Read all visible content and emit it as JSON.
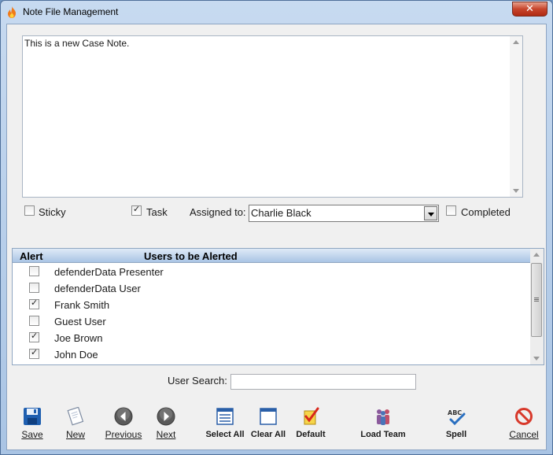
{
  "window": {
    "title": "Note File Management",
    "close_glyph": "✕"
  },
  "note": {
    "text": "This is a new Case Note."
  },
  "options": {
    "sticky_label": "Sticky",
    "sticky_checked": false,
    "task_label": "Task",
    "task_checked": true,
    "assigned_label": "Assigned to:",
    "assigned_value": "Charlie Black",
    "completed_label": "Completed",
    "completed_checked": false
  },
  "alerts": {
    "col_alert": "Alert",
    "col_users": "Users to be Alerted",
    "rows": [
      {
        "name": "defenderData Presenter",
        "checked": false
      },
      {
        "name": "defenderData User",
        "checked": false
      },
      {
        "name": "Frank Smith",
        "checked": true
      },
      {
        "name": "Guest User",
        "checked": false
      },
      {
        "name": "Joe Brown",
        "checked": true
      },
      {
        "name": "John Doe",
        "checked": true
      }
    ]
  },
  "search": {
    "label": "User Search:",
    "value": "",
    "placeholder": ""
  },
  "toolbar": {
    "save": "Save",
    "new": "New",
    "previous": "Previous",
    "next": "Next",
    "select_all": "Select All",
    "clear_all": "Clear All",
    "default": "Default",
    "load_team": "Load Team",
    "spell": "Spell",
    "cancel": "Cancel"
  },
  "icons": {
    "app": "flame-icon",
    "save": "floppy-disk-icon",
    "new": "new-document-icon",
    "previous": "arrow-left-circle-icon",
    "next": "arrow-right-circle-icon",
    "select_all": "select-all-list-icon",
    "clear_all": "clear-all-window-icon",
    "default": "checkmark-document-icon",
    "load_team": "team-people-icon",
    "spell": "spell-check-icon",
    "cancel": "cancel-circle-icon"
  },
  "colors": {
    "title_bar": "#b9d1ea",
    "close_button": "#c7452c",
    "list_header": "#a9c4e4",
    "cancel_red": "#d8392b"
  }
}
